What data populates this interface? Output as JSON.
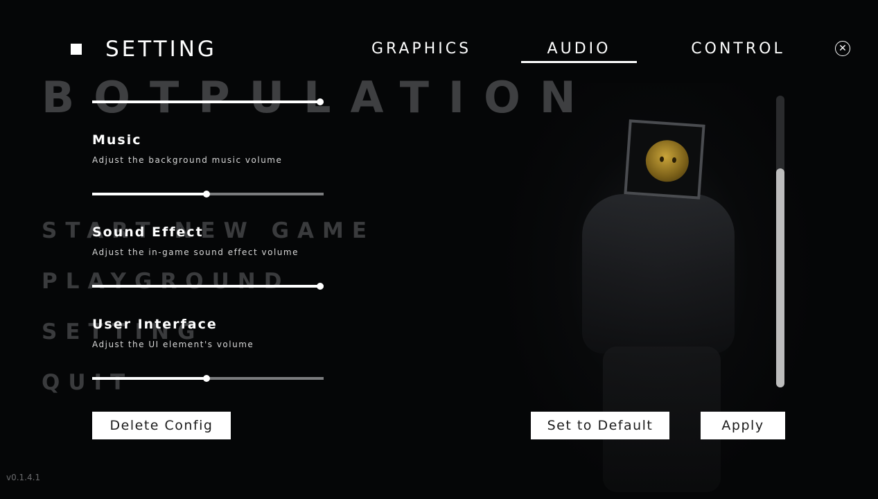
{
  "background": {
    "game_title": "BOTPULATION",
    "menu_items": [
      "START NEW GAME",
      "PLAYGROUND",
      "SETTING",
      "QUIT"
    ],
    "version": "v0.1.4.1"
  },
  "header": {
    "title": "SETTING",
    "tabs": [
      {
        "label": "GRAPHICS",
        "active": false
      },
      {
        "label": "AUDIO",
        "active": true
      },
      {
        "label": "CONTROL",
        "active": false
      }
    ],
    "close_icon": "close-circle-icon"
  },
  "audio": {
    "master": {
      "value": 1.0
    },
    "settings": [
      {
        "label": "Music",
        "description": "Adjust the background music volume",
        "value": 0.5
      },
      {
        "label": "Sound Effect",
        "description": "Adjust the in-game sound effect volume",
        "value": 1.0
      },
      {
        "label": "User Interface",
        "description": "Adjust the UI element's volume",
        "value": 0.5
      }
    ]
  },
  "scrollbar": {
    "position": 0.25,
    "visible_fraction": 0.75
  },
  "buttons": {
    "delete": "Delete Config",
    "default": "Set to Default",
    "apply": "Apply"
  },
  "colors": {
    "accent": "#ffffff",
    "track": "#7b7c7e",
    "background": "#050607"
  }
}
